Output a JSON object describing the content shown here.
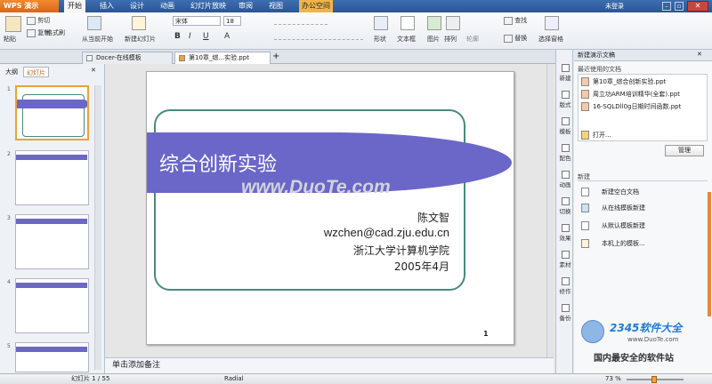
{
  "app": {
    "name": "WPS 演示",
    "login": "未登录"
  },
  "menu": {
    "tabs": [
      "开始",
      "插入",
      "设计",
      "动画",
      "幻灯片放映",
      "审阅",
      "视图",
      "办公空间"
    ],
    "active_index": 0
  },
  "ribbon": {
    "paste": "粘贴",
    "cut": "剪切",
    "copy": "复制",
    "format_painter": "格式刷",
    "from_current": "从当前开始",
    "new_slide": "新建幻灯片",
    "font_name": "宋体",
    "font_size": "18",
    "shape": "形状",
    "textbox": "文本框",
    "picture": "图片",
    "arrange": "排列",
    "outline": "轮廓",
    "find": "查找",
    "replace": "替换",
    "select_pane": "选择窗格"
  },
  "doctabs": [
    {
      "label": "Docer-在线模板",
      "active": false
    },
    {
      "label": "第10章_综...实验.ppt",
      "active": true
    }
  ],
  "leftpanel": {
    "tab_outline": "大纲",
    "tab_slides": "幻灯片",
    "thumb_numbers": [
      "1",
      "2",
      "3",
      "4",
      "5"
    ]
  },
  "slide": {
    "title": "综合创新实验",
    "author": "陈文智",
    "email": "wzchen@cad.zju.edu.cn",
    "org": "浙江大学计算机学院",
    "date": "2005年4月",
    "page_number": "1",
    "watermark": "www.DuoTe.com",
    "colors": {
      "band": "#6b67c8",
      "frame": "#4a8a7a"
    }
  },
  "notes": "单击添加备注",
  "status": {
    "slide_info": "幻灯片 1 / 55",
    "theme": "Radial",
    "zoom": "73 %"
  },
  "sidetools": [
    "新建",
    "版式",
    "模板",
    "配色",
    "动画",
    "切换",
    "效果",
    "素材",
    "修作",
    "备份"
  ],
  "taskpane": {
    "title": "新建演示文稿",
    "recent_header": "最近使用的文档",
    "recent_files": [
      "第10章_综合创新实验.ppt",
      "周立功ARM培训精华(全套).ppt",
      "16-SQLDll0g日期时间函数.ppt"
    ],
    "open": "打开...",
    "manage": "管理",
    "new_header": "新建",
    "new_items": [
      "新建空白文档",
      "从在线模板新建",
      "从默认模板新建",
      "本机上的模板..."
    ]
  },
  "watermark_logo": {
    "brand": "2345软件大全",
    "url": "www.DuoTe.com",
    "slogan": "国内最安全的软件站"
  }
}
